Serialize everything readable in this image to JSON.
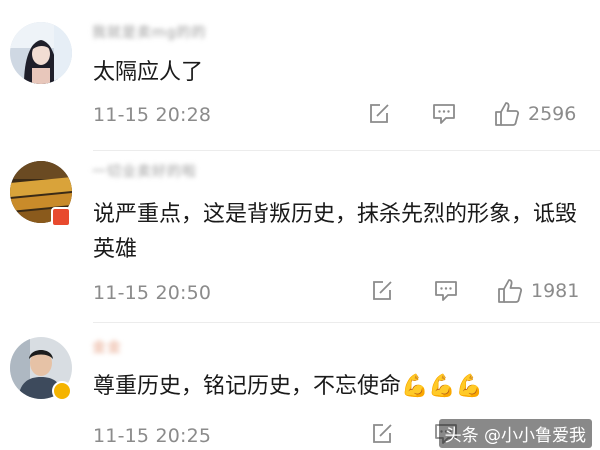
{
  "comments": [
    {
      "username": "我就是卖mg的的",
      "text": "太隔应人了",
      "time": "11-15 20:28",
      "like_count": "2596"
    },
    {
      "username": "一切业卖好的啦",
      "text": "说严重点，这是背叛历史，抹杀先烈的形象，诋毁英雄",
      "time": "11-15 20:50",
      "like_count": "1981"
    },
    {
      "username": "金金",
      "text": "尊重历史，铭记历史，不忘使命💪💪💪",
      "time": "11-15 20:25",
      "like_count": ""
    }
  ],
  "watermark": "头条 @小小鲁爱我",
  "icons": {
    "share": "share-edit-icon",
    "comment": "comment-bubble-icon",
    "like": "thumbs-up-icon"
  },
  "colors": {
    "text": "#1a1a1a",
    "meta": "#8b8b8b",
    "verified_badge": "#f5b400"
  }
}
